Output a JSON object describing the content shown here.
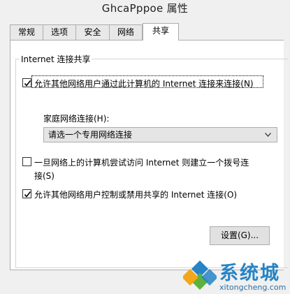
{
  "window": {
    "title": "GhcaPppoe 属性"
  },
  "tabs": [
    {
      "label": "常规",
      "active": false
    },
    {
      "label": "选项",
      "active": false
    },
    {
      "label": "安全",
      "active": false
    },
    {
      "label": "网络",
      "active": false
    },
    {
      "label": "共享",
      "active": true
    }
  ],
  "sharing": {
    "group_label": "Internet 连接共享",
    "allow_share": {
      "label": "允许其他网络用户通过此计算机的 Internet 连接来连接(N)",
      "checked": true
    },
    "home_network_label": "家庭网络连接(H):",
    "home_network_select": {
      "value": "请选一个专用网络连接"
    },
    "dial_on_demand": {
      "label_line1": "一旦网络上的计算机尝试访问 Internet 则建立一个拨号连",
      "label_line2": "接(S)",
      "checked": false
    },
    "allow_control": {
      "label": "允许其他网络用户控制或禁用共享的 Internet 连接(O)",
      "checked": true
    },
    "settings_button": "设置(G)..."
  },
  "watermark": {
    "name": "系统城",
    "url": "xitongcheng.com"
  },
  "colors": {
    "panel": "#ffffff",
    "window": "#f0f0f0",
    "border": "#adadad",
    "watermark_blue": "#2784c6",
    "logo_green": "#5bb33b"
  }
}
